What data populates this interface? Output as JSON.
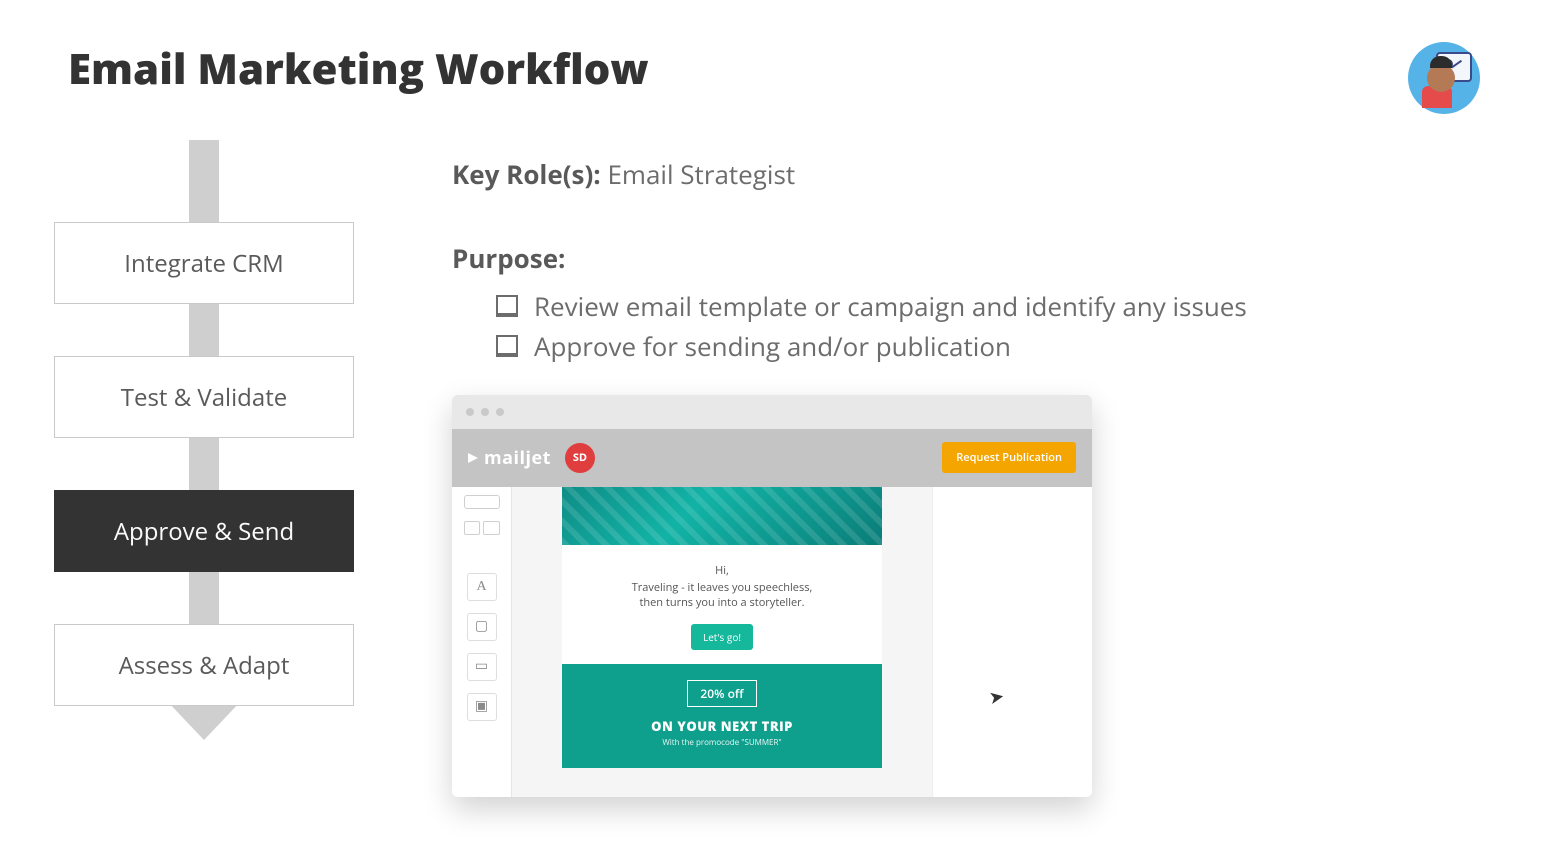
{
  "title": "Email Marketing Workflow",
  "keyRoles": {
    "label": "Key Role(s):",
    "value": "Email Strategist"
  },
  "purpose": {
    "heading": "Purpose:",
    "items": [
      "Review email template or campaign and identify any issues",
      "Approve for sending and/or publication"
    ]
  },
  "workflow": {
    "steps": [
      {
        "label": "Integrate CRM",
        "active": false
      },
      {
        "label": "Test & Validate",
        "active": false
      },
      {
        "label": "Approve & Send",
        "active": true
      },
      {
        "label": "Assess & Adapt",
        "active": false
      }
    ]
  },
  "app": {
    "brand": "mailjet",
    "userBadge": "SD",
    "requestButton": "Request Publication",
    "email": {
      "greeting": "Hi,",
      "line1": "Traveling - it leaves you speechless,",
      "line2": "then turns you into a storyteller.",
      "cta": "Let's go!",
      "promoOff": "20% off",
      "promoTrip": "ON YOUR NEXT TRIP",
      "promoCode": "With the promocode \"SUMMER\""
    },
    "sidebarIcons": [
      "A",
      "▢",
      "▭",
      "▣"
    ]
  }
}
